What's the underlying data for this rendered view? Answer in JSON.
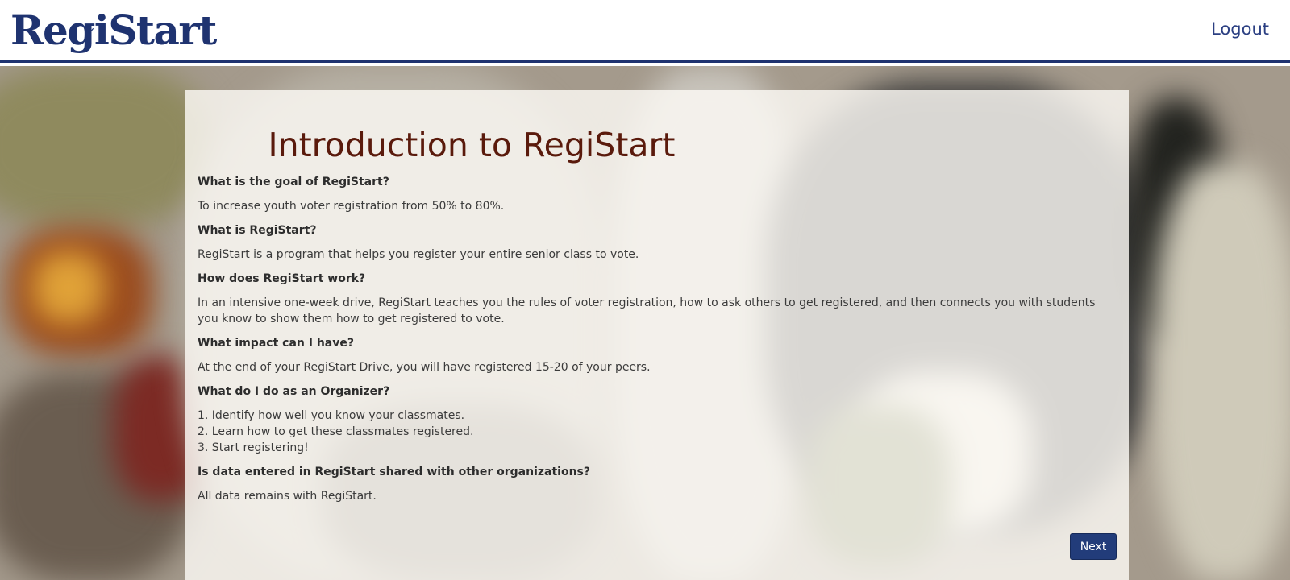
{
  "header": {
    "logo_text": "RegiStart",
    "logout_label": "Logout"
  },
  "card": {
    "title": "Introduction to RegiStart",
    "faq": [
      {
        "question": "What is the goal of RegiStart?",
        "answer": [
          "To increase youth voter registration from 50% to 80%."
        ]
      },
      {
        "question": "What is RegiStart?",
        "answer": [
          "RegiStart is a program that helps you register your entire senior class to vote."
        ]
      },
      {
        "question": "How does RegiStart work?",
        "answer": [
          "In an intensive one-week drive, RegiStart teaches you the rules of voter registration, how to ask others to get registered, and then connects you with students you know to show them how to get registered to vote."
        ]
      },
      {
        "question": "What impact can I have?",
        "answer": [
          "At the end of your RegiStart Drive, you will have registered 15-20 of your peers."
        ]
      },
      {
        "question": "What do I do as an Organizer?",
        "answer": [
          "1. Identify how well you know your classmates.",
          "2. Learn how to get these classmates registered.",
          "3. Start registering!"
        ]
      },
      {
        "question": "Is data entered in RegiStart shared with other organizations?",
        "answer": [
          "All data remains with RegiStart."
        ]
      }
    ],
    "next_label": "Next"
  },
  "colors": {
    "brand": "#1f3370",
    "title": "#5a1a0c",
    "button": "#223c7a"
  }
}
